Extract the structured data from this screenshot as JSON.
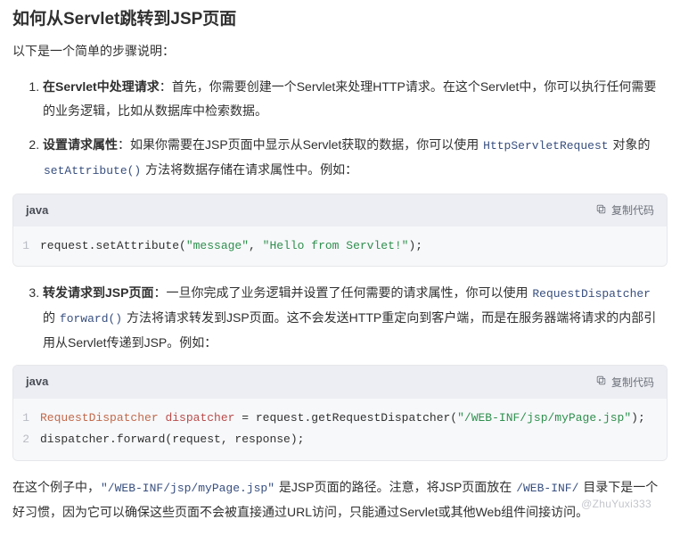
{
  "title": "如何从Servlet跳转到JSP页面",
  "intro": "以下是一个简单的步骤说明：",
  "steps": [
    {
      "lead": "在Servlet中处理请求",
      "tail": "：首先，你需要创建一个Servlet来处理HTTP请求。在这个Servlet中，你可以执行任何需要的业务逻辑，比如从数据库中检索数据。"
    },
    {
      "lead": "设置请求属性",
      "tail_a": "：如果你需要在JSP页面中显示从Servlet获取的数据，你可以使用 ",
      "code_a": "HttpServletRequest",
      "tail_b": " 对象的 ",
      "code_b": "setAttribute()",
      "tail_c": " 方法将数据存储在请求属性中。例如："
    },
    {
      "lead": "转发请求到JSP页面",
      "tail_a": "：一旦你完成了业务逻辑并设置了任何需要的请求属性，你可以使用 ",
      "code_a": "RequestDispatcher",
      "tail_b": " 的 ",
      "code_b": "forward()",
      "tail_c": " 方法将请求转发到JSP页面。这不会发送HTTP重定向到客户端，而是在服务器端将请求的内部引用从Servlet传递到JSP。例如："
    }
  ],
  "code1": {
    "lang": "java",
    "copy": "复制代码",
    "lines": [
      {
        "n": "1",
        "tokens": [
          {
            "t": "request.setAttribute(",
            "c": "pln"
          },
          {
            "t": "\"message\"",
            "c": "str"
          },
          {
            "t": ", ",
            "c": "pln"
          },
          {
            "t": "\"Hello from Servlet!\"",
            "c": "str"
          },
          {
            "t": ");",
            "c": "pln"
          }
        ]
      }
    ]
  },
  "code2": {
    "lang": "java",
    "copy": "复制代码",
    "lines": [
      {
        "n": "1",
        "tokens": [
          {
            "t": "RequestDispatcher",
            "c": "cls"
          },
          {
            "t": " ",
            "c": "pln"
          },
          {
            "t": "dispatcher",
            "c": "var"
          },
          {
            "t": " = request.getRequestDispatcher(",
            "c": "pln"
          },
          {
            "t": "\"/WEB-INF/jsp/myPage.jsp\"",
            "c": "str"
          },
          {
            "t": ");",
            "c": "pln"
          }
        ]
      },
      {
        "n": "2",
        "tokens": [
          {
            "t": "dispatcher.forward(request, response);",
            "c": "pln"
          }
        ]
      }
    ]
  },
  "after": {
    "a": "在这个例子中，",
    "code_a": "\"/WEB-INF/jsp/myPage.jsp\"",
    "b": " 是JSP页面的路径。注意，将JSP页面放在 ",
    "code_b": "/WEB-INF/",
    "c": " 目录下是一个好习惯，因为它可以确保这些页面不会被直接通过URL访问，只能通过Servlet或其他Web组件间接访问。"
  },
  "watermark": "@ZhuYuxi333"
}
